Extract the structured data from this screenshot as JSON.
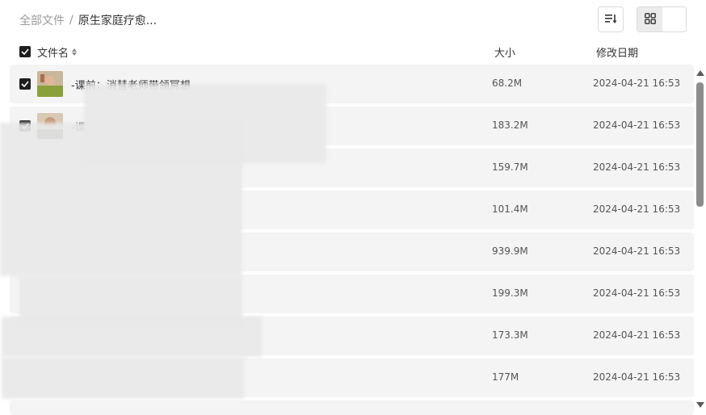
{
  "breadcrumb": {
    "root": "全部文件",
    "separator": "/",
    "current": "原生家庭疗愈..."
  },
  "toolbar": {
    "sort_icon": "sort-list-icon",
    "list_view_icon": "list-view-icon",
    "grid_view_icon": "grid-view-icon"
  },
  "columns": {
    "name": "文件名",
    "size": "大小",
    "date": "修改日期"
  },
  "files": [
    {
      "name": "-课前：消彗老师带领冥想",
      "size": "68.2M",
      "date": "2024-04-21 16:53",
      "checked": true
    },
    {
      "name": "-课",
      "size": "183.2M",
      "date": "2024-04-21 16:53",
      "checked": true
    },
    {
      "name": "",
      "size": "159.7M",
      "date": "2024-04-21 16:53",
      "checked": false
    },
    {
      "name": "",
      "size": "101.4M",
      "date": "2024-04-21 16:53",
      "checked": false
    },
    {
      "name": "",
      "size": "939.9M",
      "date": "2024-04-21 16:53",
      "checked": false
    },
    {
      "name": "",
      "size": "199.3M",
      "date": "2024-04-21 16:53",
      "checked": false
    },
    {
      "name": "",
      "size": "173.3M",
      "date": "2024-04-21 16:53",
      "checked": false
    },
    {
      "name": "",
      "size": "177M",
      "date": "2024-04-21 16:53",
      "checked": false
    }
  ]
}
